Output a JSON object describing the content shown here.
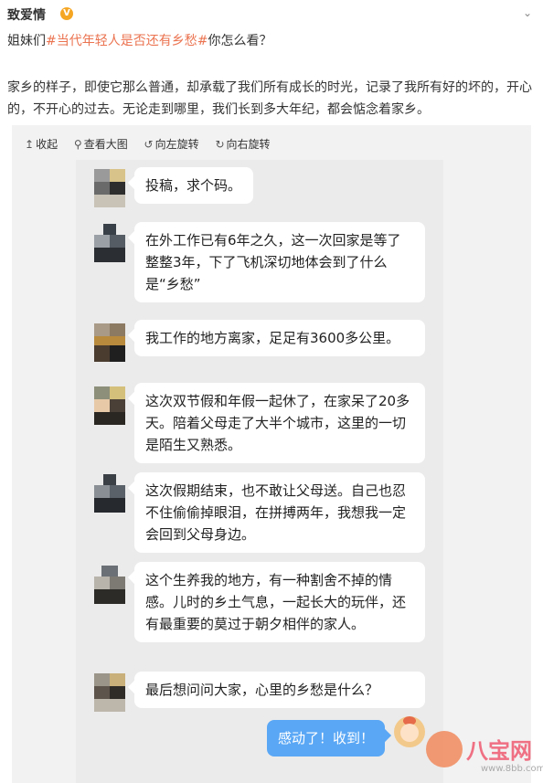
{
  "post": {
    "author": "致爱情",
    "verified_badge": "V",
    "line_prefix": "姐妹们",
    "hashtag": "#当代年轻人是否还有乡愁#",
    "line_suffix": "你怎么看？",
    "body": "家乡的样子，即使它那么普通，却承载了我们所有成长的时光，记录了我所有好的坏的，开心的，不开心的过去。无论走到哪里，我们长到多大年纪，都会惦念着家乡。"
  },
  "toolbar": {
    "collapse": "收起",
    "view_large": "查看大图",
    "rotate_left": "向左旋转",
    "rotate_right": "向右旋转"
  },
  "chat": {
    "messages": [
      "投稿，求个码。",
      "在外工作已有6年之久，这一次回家是等了整整3年，下了飞机深切地体会到了什么是“乡愁”",
      "我工作的地方离家，足足有3600多公里。",
      "这次双节假和年假一起休了，在家呆了20多天。陪着父母走了大半个城市，这里的一切是陌生又熟悉。",
      "这次假期结束，也不敢让父母送。自己也忍不住偷偷掉眼泪，在拼搏两年，我想我一定会回到父母身边。",
      "这个生养我的地方，有一种割舍不掉的情感。儿时的乡土气息，一起长大的玩伴，还有最重要的莫过于朝夕相伴的家人。",
      "最后想问问大家，心里的乡愁是什么？"
    ],
    "reply": "感动了！收到！"
  },
  "watermark": {
    "brand": "八宝网",
    "url": "www.8bb.com"
  },
  "colors": {
    "hashtag": "#eb7350",
    "reply_bubble": "#5aa7f5",
    "chat_bg": "#ebebeb"
  }
}
